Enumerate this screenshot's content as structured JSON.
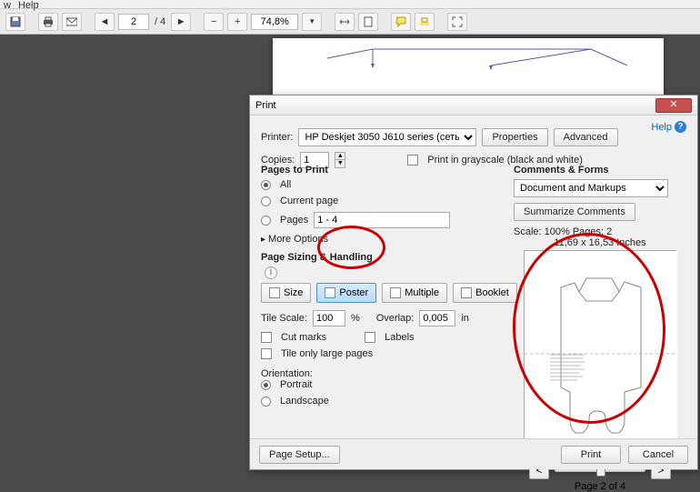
{
  "menu": {
    "view": "w",
    "help": "Help"
  },
  "toolbar": {
    "page_current": "2",
    "page_total": "/ 4",
    "zoom_value": "74,8%"
  },
  "dialog": {
    "title": "Print",
    "help": "Help",
    "printer_label": "Printer:",
    "printer_value": "HP Deskjet 3050 J610 series (сеть)",
    "properties": "Properties",
    "advanced": "Advanced",
    "copies_label": "Copies:",
    "copies_value": "1",
    "grayscale": "Print in grayscale (black and white)",
    "pages_to_print": "Pages to Print",
    "opt_all": "All",
    "opt_current": "Current page",
    "opt_pages": "Pages",
    "pages_range": "1 - 4",
    "more_options": "More Options",
    "sizing_title": "Page Sizing & Handling",
    "size": "Size",
    "poster": "Poster",
    "multiple": "Multiple",
    "booklet": "Booklet",
    "tile_scale_label": "Tile Scale:",
    "tile_scale_value": "100",
    "tile_scale_pct": "%",
    "overlap_label": "Overlap:",
    "overlap_value": "0,005",
    "overlap_unit": "in",
    "cut_marks": "Cut marks",
    "labels": "Labels",
    "tile_only": "Tile only large pages",
    "orientation_title": "Orientation:",
    "portrait": "Portrait",
    "landscape": "Landscape",
    "comments_title": "Comments & Forms",
    "comments_value": "Document and Markups",
    "summarize": "Summarize Comments",
    "scale_info": "Scale: 100% Pages: 2",
    "dims": "11,69 x 16,53 Inches",
    "page_of": "Page 2 of 4",
    "page_setup": "Page Setup...",
    "print_btn": "Print",
    "cancel_btn": "Cancel"
  }
}
